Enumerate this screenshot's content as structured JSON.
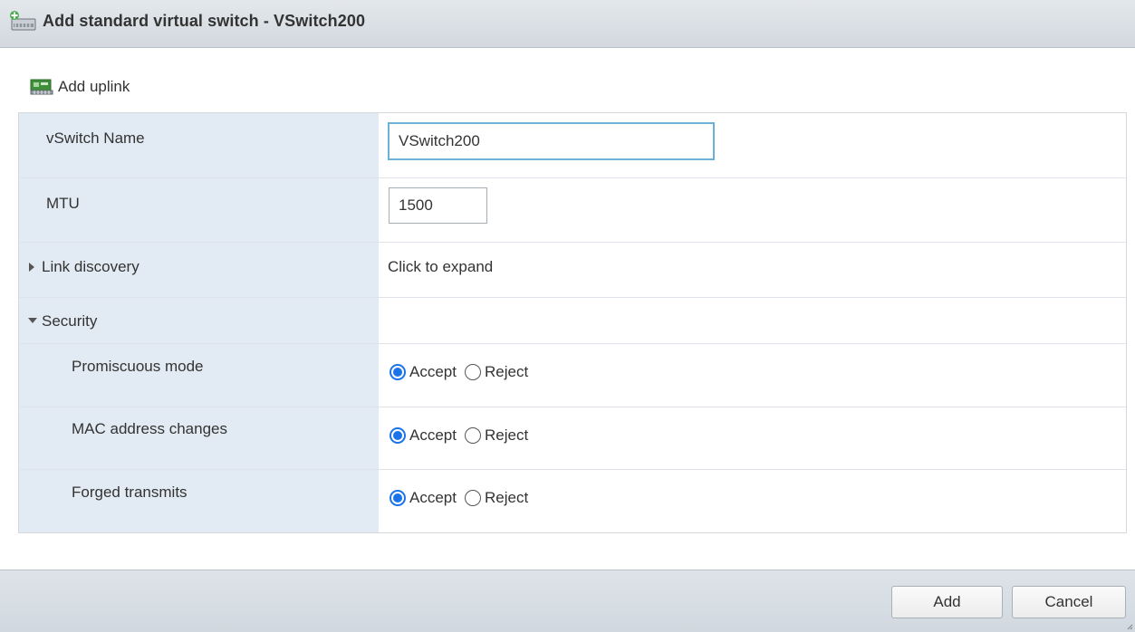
{
  "dialog": {
    "title": "Add standard virtual switch - VSwitch200",
    "title_icon": "virtual-switch-add-icon"
  },
  "toolbar": {
    "add_uplink_label": "Add uplink",
    "add_uplink_icon": "network-adapter-icon"
  },
  "form": {
    "vswitch_name": {
      "label": "vSwitch Name",
      "value": "VSwitch200"
    },
    "mtu": {
      "label": "MTU",
      "value": "1500"
    },
    "link_discovery": {
      "label": "Link discovery",
      "value": "Click to expand",
      "expanded": false
    },
    "security": {
      "label": "Security",
      "expanded": true,
      "policies": [
        {
          "label": "Promiscuous mode",
          "accept_label": "Accept",
          "reject_label": "Reject",
          "selected": "Accept"
        },
        {
          "label": "MAC address changes",
          "accept_label": "Accept",
          "reject_label": "Reject",
          "selected": "Accept"
        },
        {
          "label": "Forged transmits",
          "accept_label": "Accept",
          "reject_label": "Reject",
          "selected": "Accept"
        }
      ]
    }
  },
  "footer": {
    "add_label": "Add",
    "cancel_label": "Cancel"
  },
  "colors": {
    "accent": "#1a73e8",
    "label_background": "#e2ebf3",
    "input_focus_border": "#6cb2d6"
  }
}
